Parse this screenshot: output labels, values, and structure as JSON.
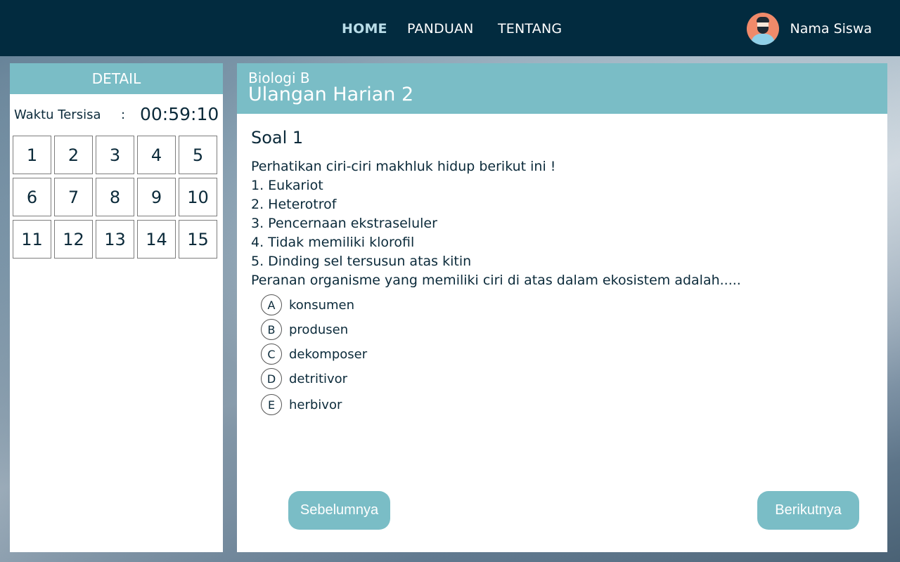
{
  "nav": {
    "items": [
      {
        "label": "HOME",
        "active": true
      },
      {
        "label": "PANDUAN",
        "active": false
      },
      {
        "label": "TENTANG",
        "active": false
      }
    ],
    "user_name": "Nama Siswa"
  },
  "detail": {
    "header": "DETAIL",
    "timer_label": "Waktu Tersisa",
    "timer_colon": ":",
    "timer_value": "00:59:10",
    "questions": [
      "1",
      "2",
      "3",
      "4",
      "5",
      "6",
      "7",
      "8",
      "9",
      "10",
      "11",
      "12",
      "13",
      "14",
      "15"
    ]
  },
  "exam": {
    "subject": "Biologi B",
    "title": "Ulangan Harian 2"
  },
  "question": {
    "title": "Soal 1",
    "lines": [
      "Perhatikan ciri-ciri makhluk hidup berikut ini !",
      "1. Eukariot",
      "2. Heterotrof",
      "3. Pencernaan ekstraseluler",
      "4. Tidak memiliki klorofil",
      "5. Dinding sel tersusun atas kitin",
      "Peranan organisme yang memiliki ciri di atas dalam ekosistem adalah....."
    ],
    "options": [
      {
        "letter": "A",
        "text": "konsumen"
      },
      {
        "letter": "B",
        "text": "produsen"
      },
      {
        "letter": "C",
        "text": "dekomposer"
      },
      {
        "letter": "D",
        "text": "detritivor"
      },
      {
        "letter": "E",
        "text": "herbivor"
      }
    ]
  },
  "buttons": {
    "prev": "Sebelumnya",
    "next": "Berikutnya"
  },
  "colors": {
    "topbar": "#022b3f",
    "accent": "#7abdc6",
    "text": "#0b2a3a"
  }
}
